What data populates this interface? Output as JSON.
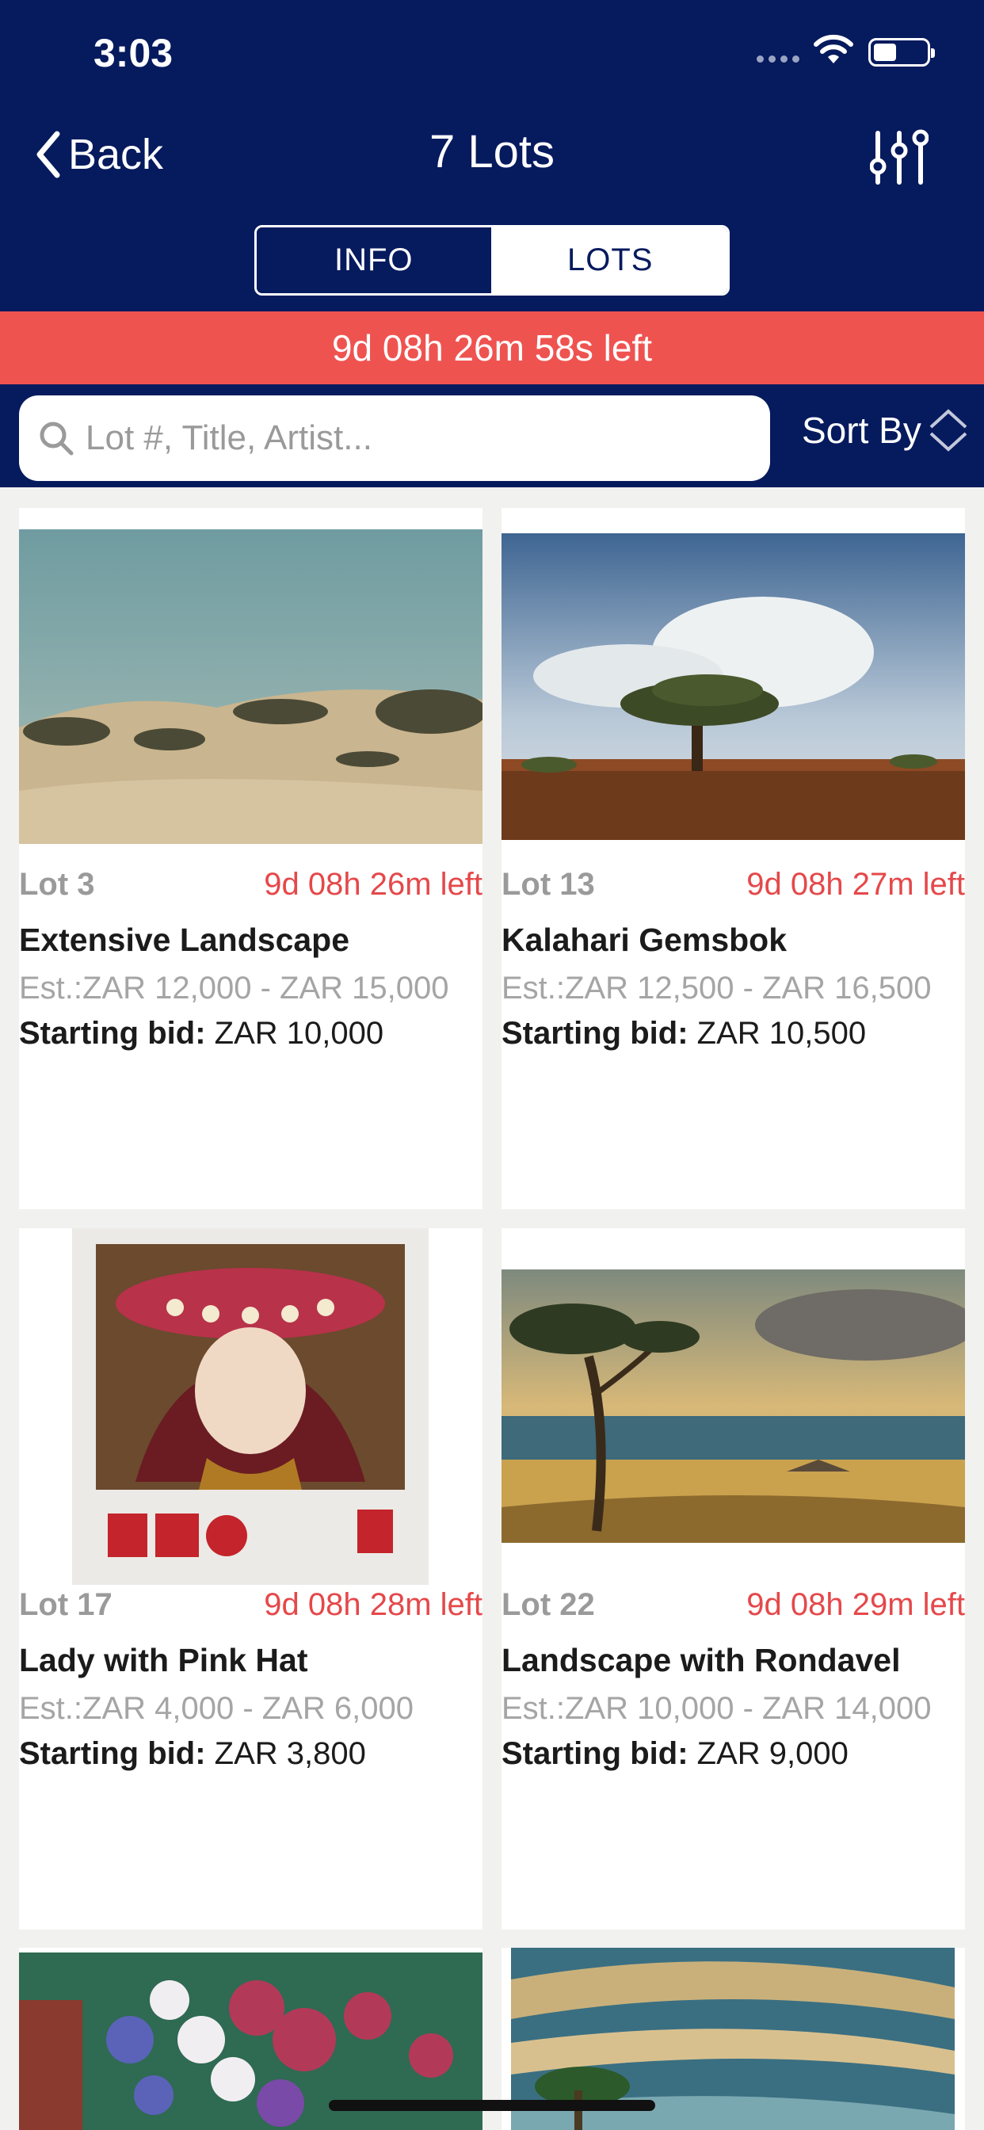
{
  "status": {
    "time": "3:03"
  },
  "nav": {
    "back_label": "Back",
    "title": "7 Lots"
  },
  "tabs": {
    "info": "INFO",
    "lots": "LOTS",
    "selected": "LOTS"
  },
  "countdown": "9d 08h 26m 58s left",
  "search": {
    "placeholder": "Lot #, Title, Artist...",
    "sort_label": "Sort By"
  },
  "lots": [
    {
      "lot": "Lot 3",
      "time_left": "9d 08h 26m left",
      "title": "Extensive Landscape",
      "estimate": "Est.:ZAR 12,000 - ZAR 15,000",
      "bid_label": "Starting bid:",
      "bid_value": " ZAR 10,000"
    },
    {
      "lot": "Lot 13",
      "time_left": "9d 08h 27m left",
      "title": "Kalahari Gemsbok",
      "estimate": "Est.:ZAR 12,500 - ZAR 16,500",
      "bid_label": "Starting bid:",
      "bid_value": " ZAR 10,500"
    },
    {
      "lot": "Lot 17",
      "time_left": "9d 08h 28m left",
      "title": "Lady with Pink Hat",
      "estimate": "Est.:ZAR 4,000 - ZAR 6,000",
      "bid_label": "Starting bid:",
      "bid_value": " ZAR 3,800"
    },
    {
      "lot": "Lot 22",
      "time_left": "9d 08h 29m left",
      "title": "Landscape with Rondavel",
      "estimate": "Est.:ZAR 10,000 - ZAR 14,000",
      "bid_label": "Starting bid:",
      "bid_value": " ZAR 9,000"
    }
  ],
  "colors": {
    "navy": "#061a5e",
    "countdown_red": "#ef5350",
    "time_left_red": "#e5484a"
  }
}
